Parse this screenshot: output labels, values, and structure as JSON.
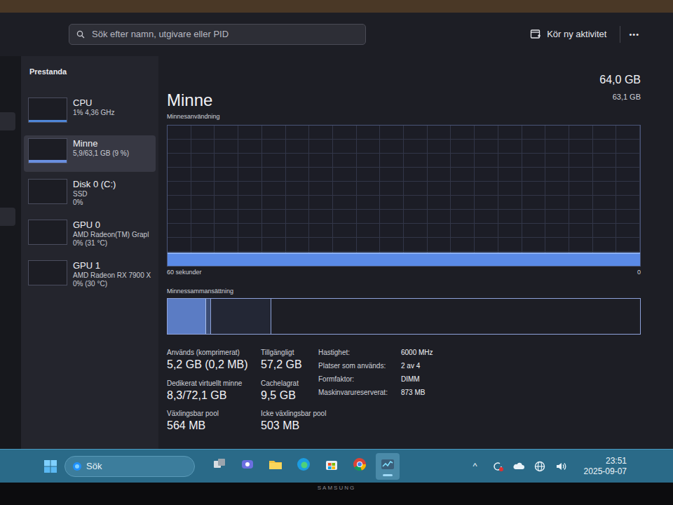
{
  "search": {
    "placeholder": "Sök efter namn, utgivare eller PID"
  },
  "toolbar": {
    "run_task": "Kör ny aktivitet",
    "more": "•••"
  },
  "sidebar": {
    "title": "Prestanda",
    "items": [
      {
        "kind": "cpu",
        "lines": [
          "CPU",
          "1% 4,36 GHz"
        ],
        "level": 0.01,
        "selected": false
      },
      {
        "kind": "memory",
        "lines": [
          "Minne",
          "5,9/63,1 GB (9 %)"
        ],
        "level": 0.09,
        "selected": true
      },
      {
        "kind": "disk",
        "lines": [
          "Disk 0 (C:)",
          "SSD",
          "0%"
        ],
        "level": 0,
        "selected": false
      },
      {
        "kind": "gpu",
        "lines": [
          "GPU 0",
          "AMD Radeon(TM) Grapl",
          "0% (31 °C)"
        ],
        "level": 0,
        "selected": false
      },
      {
        "kind": "gpu",
        "lines": [
          "GPU 1",
          "AMD Radeon RX 7900 X",
          "0% (30 °C)"
        ],
        "level": 0,
        "selected": false
      }
    ]
  },
  "main": {
    "title": "Minne",
    "total": "64,0 GB",
    "usable": "63,1 GB",
    "graph": {
      "label": "Minnesanvändning",
      "x_left": "60 sekunder",
      "x_right": "0",
      "axis_max": 64.0,
      "values": [
        5.9,
        5.9,
        5.9,
        5.9,
        5.9,
        5.9,
        5.9,
        5.9,
        5.9,
        5.9,
        5.9,
        5.9,
        5.9,
        5.9,
        5.9,
        5.9,
        5.9,
        5.9,
        5.9,
        5.9,
        5.9,
        5.9,
        5.9,
        5.9,
        5.9,
        5.9,
        5.9,
        5.9,
        5.9,
        5.9
      ]
    },
    "composition": {
      "label": "Minnessammansättning",
      "segments": [
        {
          "kind": "in-use",
          "level": 0.08
        },
        {
          "kind": "modified",
          "level": 0.01
        },
        {
          "kind": "standby",
          "level": 0.13
        },
        {
          "kind": "free",
          "level": 0.78
        }
      ]
    },
    "stats": [
      {
        "label": "Används (komprimerat)",
        "value": "5,2 GB (0,2 MB)"
      },
      {
        "label": "Tillgängligt",
        "value": "57,2 GB"
      },
      {
        "label": "Dedikerat virtuellt minne",
        "value": "8,3/72,1 GB"
      },
      {
        "label": "Cachelagrat",
        "value": "9,5 GB"
      },
      {
        "label": "Växlingsbar pool",
        "value": "564 MB"
      },
      {
        "label": "Icke växlingsbar pool",
        "value": "503 MB"
      }
    ],
    "details": [
      {
        "label": "Hastighet:",
        "value": "6000 MHz"
      },
      {
        "label": "Platser som används:",
        "value": "2 av 4"
      },
      {
        "label": "Formfaktor:",
        "value": "DIMM"
      },
      {
        "label": "Maskinvarureserverat:",
        "value": "873 MB"
      }
    ]
  },
  "taskbar": {
    "search": "Sök",
    "pinned": [
      {
        "kind": "task-view",
        "selected": false
      },
      {
        "kind": "meet",
        "selected": false
      },
      {
        "kind": "explorer",
        "selected": false
      },
      {
        "kind": "edge",
        "selected": false
      },
      {
        "kind": "store",
        "selected": false
      },
      {
        "kind": "chrome",
        "selected": false
      },
      {
        "kind": "task-manager",
        "selected": true
      }
    ],
    "tray_toggle": "^",
    "tray": [
      {
        "kind": "update"
      },
      {
        "kind": "cloud"
      },
      {
        "kind": "network"
      },
      {
        "kind": "volume"
      }
    ],
    "time": "23:51",
    "date": "2025-09-07"
  },
  "monitor": {
    "brand": "SAMSUNG"
  }
}
